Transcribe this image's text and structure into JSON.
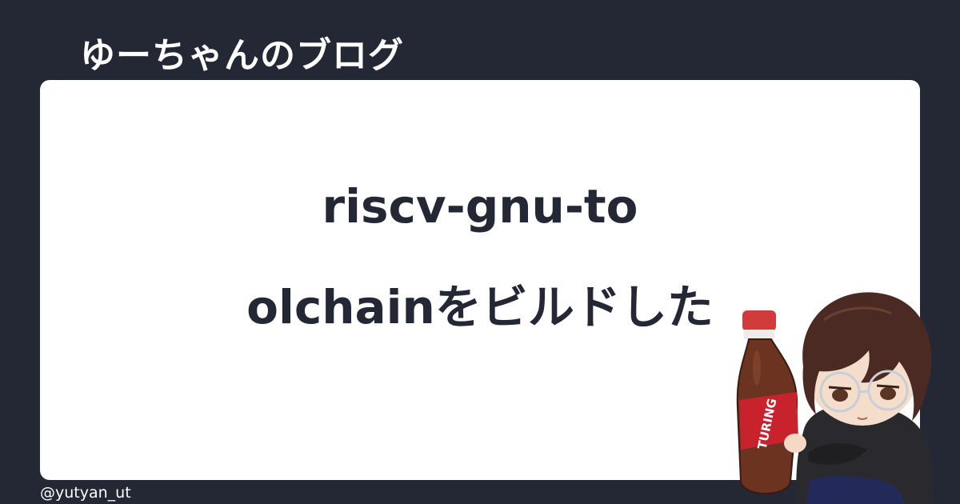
{
  "header": {
    "blog_name": "ゆーちゃんのブログ"
  },
  "article": {
    "title_line1": "riscv-gnu-to",
    "title_line2": "olchainをビルドした"
  },
  "footer": {
    "handle": "@yutyan_ut"
  },
  "illustration": {
    "bottle_label": "TURING"
  },
  "colors": {
    "background": "#232834",
    "card": "#ffffff",
    "title_text": "#232834",
    "header_text": "#ffffff"
  }
}
